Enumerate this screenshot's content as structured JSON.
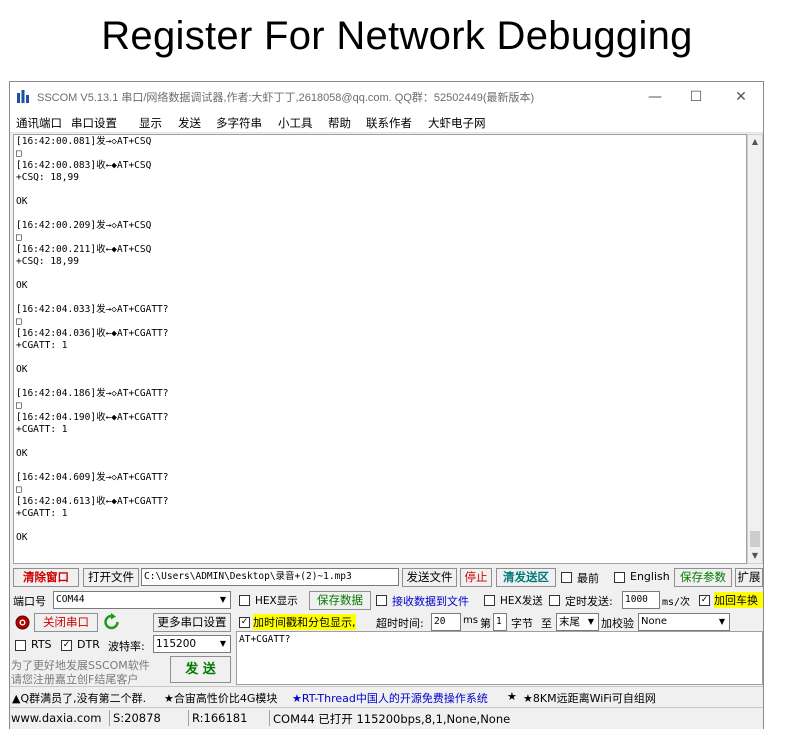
{
  "heading": "Register For Network Debugging",
  "window": {
    "title": "SSCOM V5.13.1 串口/网络数据调试器,作者:大虾丁丁,2618058@qq.com. QQ群：52502449(最新版本)",
    "minimize": "—",
    "maximize": "☐",
    "close": "✕"
  },
  "menu": [
    "通讯端口",
    "串口设置",
    "显示",
    "发送",
    "多字符串",
    "小工具",
    "帮助",
    "联系作者",
    "大虾电子网"
  ],
  "log_lines": [
    "[16:42:00.081]发→◇AT+CSQ",
    "□",
    "[16:42:00.083]收←◆AT+CSQ",
    "+CSQ: 18,99",
    "",
    "OK",
    "",
    "[16:42:00.209]发→◇AT+CSQ",
    "□",
    "[16:42:00.211]收←◆AT+CSQ",
    "+CSQ: 18,99",
    "",
    "OK",
    "",
    "[16:42:04.033]发→◇AT+CGATT?",
    "□",
    "[16:42:04.036]收←◆AT+CGATT?",
    "+CGATT: 1",
    "",
    "OK",
    "",
    "[16:42:04.186]发→◇AT+CGATT?",
    "□",
    "[16:42:04.190]收←◆AT+CGATT?",
    "+CGATT: 1",
    "",
    "OK",
    "",
    "[16:42:04.609]发→◇AT+CGATT?",
    "□",
    "[16:42:04.613]收←◆AT+CGATT?",
    "+CGATT: 1",
    "",
    "OK"
  ],
  "row1": {
    "clear_window": "清除窗口",
    "open_file": "打开文件",
    "file_path": "C:\\Users\\ADMIN\\Desktop\\录音+(2)~1.mp3",
    "send_file": "发送文件",
    "stop": "停止",
    "clear_send": "清发送区",
    "latest": "最前",
    "english": "English",
    "save_params": "保存参数",
    "expand": "扩展"
  },
  "row2": {
    "port_label": "端口号",
    "port_value": "COM44",
    "hex_display": "HEX显示",
    "save_data": "保存数据",
    "recv_to_file": "接收数据到文件",
    "hex_send": "HEX发送",
    "timed_send": "定时发送:",
    "interval": "1000",
    "interval_unit": "ms/次",
    "add_crlf": "加回车换"
  },
  "row3": {
    "close_port": "关闭串口",
    "more_settings": "更多串口设置",
    "timestamp": "加时间戳和分包显示,",
    "timeout_label": "超时时间:",
    "timeout_value": "20",
    "timeout_unit": "ms",
    "nth_label": "第",
    "nth_value": "1",
    "byte_label": "字节",
    "to_label": "至",
    "end_value": "末尾",
    "checksum_label": "加校验",
    "checksum_value": "None"
  },
  "row4": {
    "rts": "RTS",
    "dtr": "DTR",
    "baud_label": "波特率:",
    "baud_value": "115200"
  },
  "promo": {
    "line1": "为了更好地发展SSCOM软件",
    "line2": "请您注册嘉立创F结尾客户"
  },
  "send_button": "发 送",
  "send_text": "AT+CGATT?",
  "ad": {
    "part1": "▲Q群满员了,没有第二个群.",
    "part2": "★合宙高性价比4G模块",
    "part3": "★RT-Thread中国人的开源免费操作系统",
    "part4": "★",
    "part5": "★8KM远距离WiFi可自组网"
  },
  "status": {
    "site": "www.daxia.com",
    "sent": "S:20878",
    "received": "R:166181",
    "port_status": "COM44 已打开  115200bps,8,1,None,None"
  },
  "colors": {
    "red_text": "#d00000",
    "green_text": "#007a00",
    "blue_text": "#0000cc",
    "yellow_highlight": "#ffff00"
  }
}
